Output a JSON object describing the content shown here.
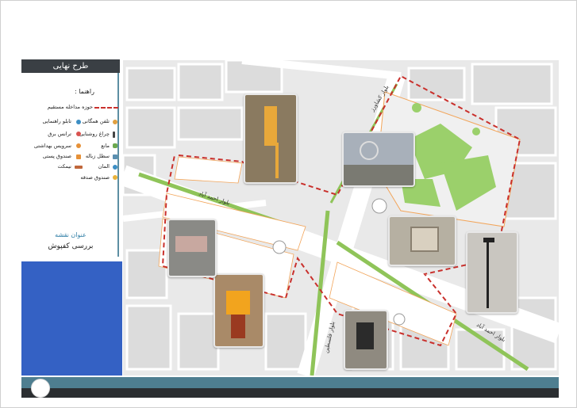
{
  "panel": {
    "title": "طرح نهایی",
    "legend_heading": "راهنما :",
    "boundary_label": "حوزه مداخله مستقیم",
    "legend_right": [
      "تلفن همگانی",
      "چراغ روشنایی",
      "مانع",
      "سطل زباله",
      "المان",
      "صندوق صدقه"
    ],
    "legend_left": [
      "تابلو راهنمایی",
      "ترانس برق",
      "سرویس بهداشتی",
      "صندوق پستی",
      "نیمکت"
    ],
    "map_title_label": "عنوان نقشه",
    "map_title_value": "بررسی کفپوش"
  },
  "map": {
    "street_labels": [
      "بلوار کشاورز",
      "بلوار احمد آباد",
      "بلوار احمد آباد",
      "بلوار فلسطین"
    ],
    "photo_captions": [
      "telephone-booth",
      "fountain-plaza",
      "information-board",
      "street-lamp",
      "trash-bin",
      "post-box",
      "stone-bench"
    ]
  },
  "colors": {
    "boundary": "#c9302c",
    "green_strip": "#8fc459",
    "block": "#e6e6e6",
    "road": "#ffffff",
    "footer_teal": "#4e7e90",
    "footer_dark": "#2b2e31",
    "blue_box": "#3461c4",
    "panel_title_bg": "#3a3f44"
  }
}
